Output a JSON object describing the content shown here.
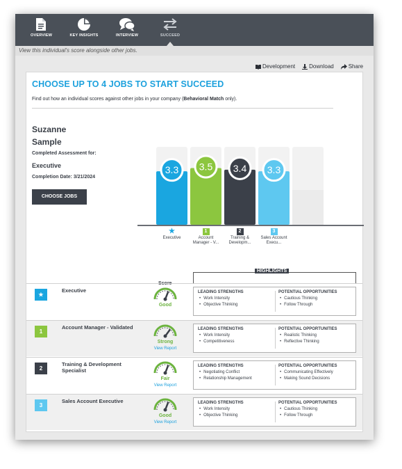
{
  "nav": {
    "tabs": [
      {
        "label": "OVERVIEW",
        "icon": "document-icon"
      },
      {
        "label": "KEY INSIGHTS",
        "icon": "pie-chart-icon"
      },
      {
        "label": "INTERVIEW",
        "icon": "chat-bubbles-icon"
      },
      {
        "label": "SUCCEED",
        "icon": "swap-arrows-icon",
        "active": true
      }
    ]
  },
  "info_bar": "View this individual's score alongside other jobs.",
  "actions": {
    "development": "Development",
    "download": "Download",
    "share": "Share"
  },
  "heading": "CHOOSE UP TO 4 JOBS TO START SUCCEED",
  "subtitle": {
    "prefix": "Find out how an individual scores against other jobs in your company (",
    "bold": "Behavioral Match",
    "suffix": " only)."
  },
  "person": {
    "first_name": "Suzanne",
    "last_name": "Sample",
    "completed_for_label": "Completed Assessment for:",
    "job": "Executive",
    "completion_date": "Completion Date: 3/21/2024"
  },
  "choose_jobs_button": "CHOOSE JOBS",
  "chart_data": {
    "type": "bar",
    "categories": [
      "Executive",
      "Account Manager - V...",
      "Training & Developm...",
      "Sales Account Execu..."
    ],
    "markers": [
      "★",
      "1",
      "2",
      "3"
    ],
    "values": [
      3.3,
      3.5,
      3.4,
      3.3
    ],
    "colors": [
      "#1aa6e0",
      "#8cc63f",
      "#3b4049",
      "#5ec8f0"
    ],
    "empty_slot": true
  },
  "table": {
    "score_header": "Score",
    "highlights_header": "HIGHLIGHTS",
    "strengths_title": "LEADING STRENGTHS",
    "opportunities_title": "POTENTIAL OPPORTUNITIES",
    "rows": [
      {
        "marker": "★",
        "color": "#1aa6e0",
        "job": "Executive",
        "rating": "Good",
        "view_report": "",
        "strengths": [
          "Work Intensity",
          "Objective Thinking"
        ],
        "opportunities": [
          "Cautious Thinking",
          "Follow Through"
        ],
        "needle": 0.62
      },
      {
        "marker": "1",
        "color": "#8cc63f",
        "job": "Account Manager - Validated",
        "rating": "Strong",
        "view_report": "View Report",
        "strengths": [
          "Work Intensity",
          "Competitiveness"
        ],
        "opportunities": [
          "Realistic Thinking",
          "Reflective Thinking"
        ],
        "needle": 0.7
      },
      {
        "marker": "2",
        "color": "#3b4049",
        "job": "Training & Development Specialist",
        "rating": "Fair",
        "view_report": "View Report",
        "strengths": [
          "Negotiating Conflict",
          "Relationship Management"
        ],
        "opportunities": [
          "Communicating Effectively",
          "Making Sound Decisions"
        ],
        "needle": 0.62
      },
      {
        "marker": "3",
        "color": "#5ec8f0",
        "job": "Sales Account Executive",
        "rating": "Good",
        "view_report": "View Report",
        "strengths": [
          "Work Intensity",
          "Objective Thinking"
        ],
        "opportunities": [
          "Cautious Thinking",
          "Follow Through"
        ],
        "needle": 0.62
      }
    ]
  }
}
